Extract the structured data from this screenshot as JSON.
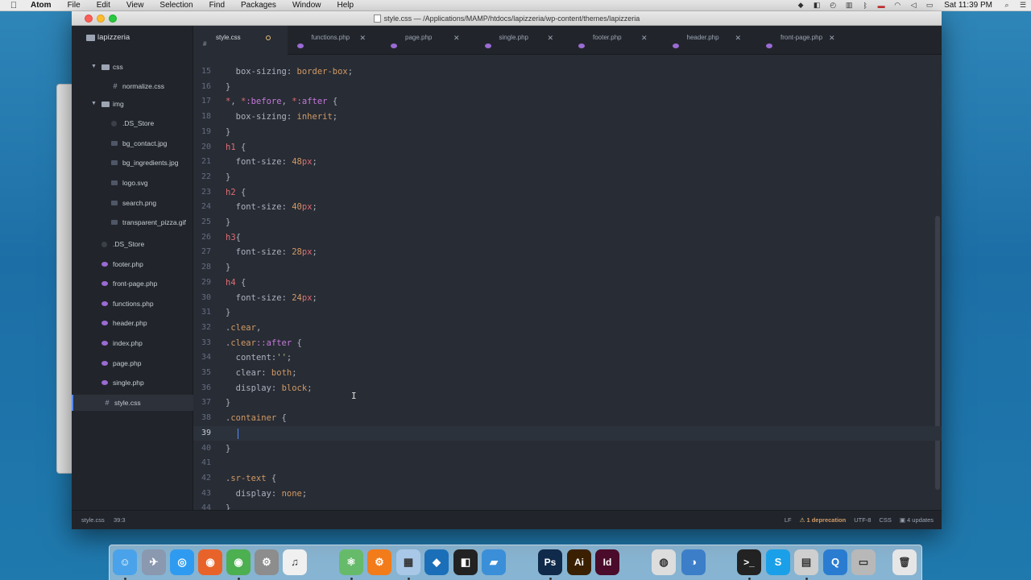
{
  "menubar": {
    "apple": "",
    "items": [
      "Atom",
      "File",
      "Edit",
      "View",
      "Selection",
      "Find",
      "Packages",
      "Window",
      "Help"
    ],
    "clock": "Sat 11:39 PM"
  },
  "window": {
    "title": "style.css — /Applications/MAMP/htdocs/lapizzeria/wp-content/themes/lapizzeria"
  },
  "tree": {
    "root": "lapizzeria",
    "items": [
      {
        "name": "css",
        "type": "dir",
        "depth": 1,
        "expanded": true
      },
      {
        "name": "normalize.css",
        "type": "css",
        "depth": 2
      },
      {
        "name": "img",
        "type": "dir",
        "depth": 1,
        "expanded": true
      },
      {
        "name": ".DS_Store",
        "type": "ds",
        "depth": 2
      },
      {
        "name": "bg_contact.jpg",
        "type": "img",
        "depth": 2
      },
      {
        "name": "bg_ingredients.jpg",
        "type": "img",
        "depth": 2
      },
      {
        "name": "logo.svg",
        "type": "img",
        "depth": 2
      },
      {
        "name": "search.png",
        "type": "img",
        "depth": 2
      },
      {
        "name": "transparent_pizza.gif",
        "type": "img",
        "depth": 2
      },
      {
        "name": ".DS_Store",
        "type": "ds",
        "depth": 1
      },
      {
        "name": "footer.php",
        "type": "php",
        "depth": 1
      },
      {
        "name": "front-page.php",
        "type": "php",
        "depth": 1
      },
      {
        "name": "functions.php",
        "type": "php",
        "depth": 1
      },
      {
        "name": "header.php",
        "type": "php",
        "depth": 1
      },
      {
        "name": "index.php",
        "type": "php",
        "depth": 1
      },
      {
        "name": "page.php",
        "type": "php",
        "depth": 1
      },
      {
        "name": "single.php",
        "type": "php",
        "depth": 1
      },
      {
        "name": "style.css",
        "type": "css",
        "depth": 1,
        "selected": true
      }
    ]
  },
  "tabs": [
    {
      "label": "style.css",
      "icon": "hash",
      "active": true,
      "modified": true
    },
    {
      "label": "functions.php",
      "icon": "php",
      "active": false,
      "modified": false
    },
    {
      "label": "page.php",
      "icon": "php",
      "active": false,
      "modified": false
    },
    {
      "label": "single.php",
      "icon": "php",
      "active": false,
      "modified": false
    },
    {
      "label": "footer.php",
      "icon": "php",
      "active": false,
      "modified": false
    },
    {
      "label": "header.php",
      "icon": "php",
      "active": false,
      "modified": false
    },
    {
      "label": "front-page.php",
      "icon": "php",
      "active": false,
      "modified": false
    }
  ],
  "editor": {
    "current_line": 39,
    "lines": [
      {
        "n": 15,
        "tokens": [
          [
            "  ",
            ""
          ],
          [
            "box-sizing",
            "prop"
          ],
          [
            ": ",
            "punc"
          ],
          [
            "border-box",
            "val"
          ],
          [
            ";",
            "punc"
          ]
        ]
      },
      {
        "n": 16,
        "tokens": [
          [
            "}",
            "punc"
          ]
        ]
      },
      {
        "n": 17,
        "tokens": [
          [
            "*",
            "sel"
          ],
          [
            ", ",
            "punc"
          ],
          [
            "*",
            "sel"
          ],
          [
            ":before",
            "pseudo"
          ],
          [
            ", ",
            "punc"
          ],
          [
            "*",
            "sel"
          ],
          [
            ":after",
            "pseudo"
          ],
          [
            " {",
            "punc"
          ]
        ]
      },
      {
        "n": 18,
        "tokens": [
          [
            "  ",
            ""
          ],
          [
            "box-sizing",
            "prop"
          ],
          [
            ": ",
            "punc"
          ],
          [
            "inherit",
            "val"
          ],
          [
            ";",
            "punc"
          ]
        ]
      },
      {
        "n": 19,
        "tokens": [
          [
            "}",
            "punc"
          ]
        ]
      },
      {
        "n": 20,
        "tokens": [
          [
            "h1",
            "sel"
          ],
          [
            " {",
            "punc"
          ]
        ]
      },
      {
        "n": 21,
        "tokens": [
          [
            "  ",
            ""
          ],
          [
            "font-size",
            "prop"
          ],
          [
            ": ",
            "punc"
          ],
          [
            "48",
            "num"
          ],
          [
            "px",
            "unit"
          ],
          [
            ";",
            "punc"
          ]
        ]
      },
      {
        "n": 22,
        "tokens": [
          [
            "}",
            "punc"
          ]
        ]
      },
      {
        "n": 23,
        "tokens": [
          [
            "h2",
            "sel"
          ],
          [
            " {",
            "punc"
          ]
        ]
      },
      {
        "n": 24,
        "tokens": [
          [
            "  ",
            ""
          ],
          [
            "font-size",
            "prop"
          ],
          [
            ": ",
            "punc"
          ],
          [
            "40",
            "num"
          ],
          [
            "px",
            "unit"
          ],
          [
            ";",
            "punc"
          ]
        ]
      },
      {
        "n": 25,
        "tokens": [
          [
            "}",
            "punc"
          ]
        ]
      },
      {
        "n": 26,
        "tokens": [
          [
            "h3",
            "sel"
          ],
          [
            "{",
            "punc"
          ]
        ]
      },
      {
        "n": 27,
        "tokens": [
          [
            "  ",
            ""
          ],
          [
            "font-size",
            "prop"
          ],
          [
            ": ",
            "punc"
          ],
          [
            "28",
            "num"
          ],
          [
            "px",
            "unit"
          ],
          [
            ";",
            "punc"
          ]
        ]
      },
      {
        "n": 28,
        "tokens": [
          [
            "}",
            "punc"
          ]
        ]
      },
      {
        "n": 29,
        "tokens": [
          [
            "h4",
            "sel"
          ],
          [
            " {",
            "punc"
          ]
        ]
      },
      {
        "n": 30,
        "tokens": [
          [
            "  ",
            ""
          ],
          [
            "font-size",
            "prop"
          ],
          [
            ": ",
            "punc"
          ],
          [
            "24",
            "num"
          ],
          [
            "px",
            "unit"
          ],
          [
            ";",
            "punc"
          ]
        ]
      },
      {
        "n": 31,
        "tokens": [
          [
            "}",
            "punc"
          ]
        ]
      },
      {
        "n": 32,
        "tokens": [
          [
            ".",
            "punc"
          ],
          [
            "clear",
            "cls"
          ],
          [
            ",",
            "punc"
          ]
        ]
      },
      {
        "n": 33,
        "tokens": [
          [
            ".",
            "punc"
          ],
          [
            "clear",
            "cls"
          ],
          [
            "::after",
            "pseudo"
          ],
          [
            " {",
            "punc"
          ]
        ]
      },
      {
        "n": 34,
        "tokens": [
          [
            "  ",
            ""
          ],
          [
            "content",
            "prop"
          ],
          [
            ":",
            "punc"
          ],
          [
            "''",
            "str"
          ],
          [
            ";",
            "punc"
          ]
        ]
      },
      {
        "n": 35,
        "tokens": [
          [
            "  ",
            ""
          ],
          [
            "clear",
            "prop"
          ],
          [
            ": ",
            "punc"
          ],
          [
            "both",
            "val"
          ],
          [
            ";",
            "punc"
          ]
        ]
      },
      {
        "n": 36,
        "tokens": [
          [
            "  ",
            ""
          ],
          [
            "display",
            "prop"
          ],
          [
            ": ",
            "punc"
          ],
          [
            "block",
            "val"
          ],
          [
            ";",
            "punc"
          ]
        ]
      },
      {
        "n": 37,
        "tokens": [
          [
            "}",
            "punc"
          ]
        ]
      },
      {
        "n": 38,
        "tokens": [
          [
            ".",
            "punc"
          ],
          [
            "container",
            "cls"
          ],
          [
            " {",
            "punc"
          ]
        ]
      },
      {
        "n": 39,
        "tokens": [
          [
            "  ",
            ""
          ]
        ]
      },
      {
        "n": 40,
        "tokens": [
          [
            "}",
            "punc"
          ]
        ]
      },
      {
        "n": 41,
        "tokens": []
      },
      {
        "n": 42,
        "tokens": [
          [
            ".",
            "punc"
          ],
          [
            "sr-text",
            "cls"
          ],
          [
            " {",
            "punc"
          ]
        ]
      },
      {
        "n": 43,
        "tokens": [
          [
            "  ",
            ""
          ],
          [
            "display",
            "prop"
          ],
          [
            ": ",
            "punc"
          ],
          [
            "none",
            "val"
          ],
          [
            ";",
            "punc"
          ]
        ]
      },
      {
        "n": 44,
        "tokens": [
          [
            "}",
            "punc"
          ]
        ]
      }
    ]
  },
  "statusbar": {
    "file": "style.css",
    "cursor": "39:3",
    "line_ending": "LF",
    "warning_icon": "⚠",
    "deprecation": "1 deprecation",
    "encoding": "UTF-8",
    "grammar": "CSS",
    "updates": "4 updates"
  },
  "dock": {
    "apps": [
      {
        "name": "finder-icon",
        "glyph": "☺",
        "color": "#4aa3ea"
      },
      {
        "name": "launchpad-icon",
        "glyph": "✈",
        "color": "#8a98b0"
      },
      {
        "name": "safari-icon",
        "glyph": "◎",
        "color": "#2f9bf0"
      },
      {
        "name": "firefox-icon",
        "glyph": "◉",
        "color": "#e8632a"
      },
      {
        "name": "chrome-icon",
        "glyph": "◉",
        "color": "#4caf50"
      },
      {
        "name": "system-preferences-icon",
        "glyph": "⚙",
        "color": "#8d8d8d"
      },
      {
        "name": "itunes-icon",
        "glyph": "♫",
        "color": "#f0f0f0"
      },
      {
        "name": "atom-icon",
        "glyph": "⚛",
        "color": "#66bb6a"
      },
      {
        "name": "settings-gear-icon",
        "glyph": "⚙",
        "color": "#f27b1a"
      },
      {
        "name": "box-icon",
        "glyph": "▦",
        "color": "#a9c8e8"
      },
      {
        "name": "vscode-icon",
        "glyph": "◆",
        "color": "#1a6fb8"
      },
      {
        "name": "tool-icon",
        "glyph": "◧",
        "color": "#222"
      },
      {
        "name": "file-icon",
        "glyph": "▰",
        "color": "#3a8fd8"
      },
      {
        "name": "photoshop-icon",
        "glyph": "Ps",
        "color": "#0f2a4a"
      },
      {
        "name": "illustrator-icon",
        "glyph": "Ai",
        "color": "#3a2000"
      },
      {
        "name": "indesign-icon",
        "glyph": "Id",
        "color": "#4a0c2a"
      },
      {
        "name": "sequel-icon",
        "glyph": "◍",
        "color": "#dddddd"
      },
      {
        "name": "database-icon",
        "glyph": "◑",
        "color": "#3d7ec9"
      },
      {
        "name": "terminal-icon",
        "glyph": ">_",
        "color": "#222"
      },
      {
        "name": "skype-icon",
        "glyph": "S",
        "color": "#1aa0e8"
      },
      {
        "name": "photos-icon",
        "glyph": "▤",
        "color": "#cfcfcf"
      },
      {
        "name": "quicktime-icon",
        "glyph": "Q",
        "color": "#2a7cd1"
      },
      {
        "name": "preview-icon",
        "glyph": "▭",
        "color": "#b8b8b8"
      },
      {
        "name": "trash-icon",
        "glyph": "🗑",
        "color": "#e6e6e6"
      }
    ]
  }
}
